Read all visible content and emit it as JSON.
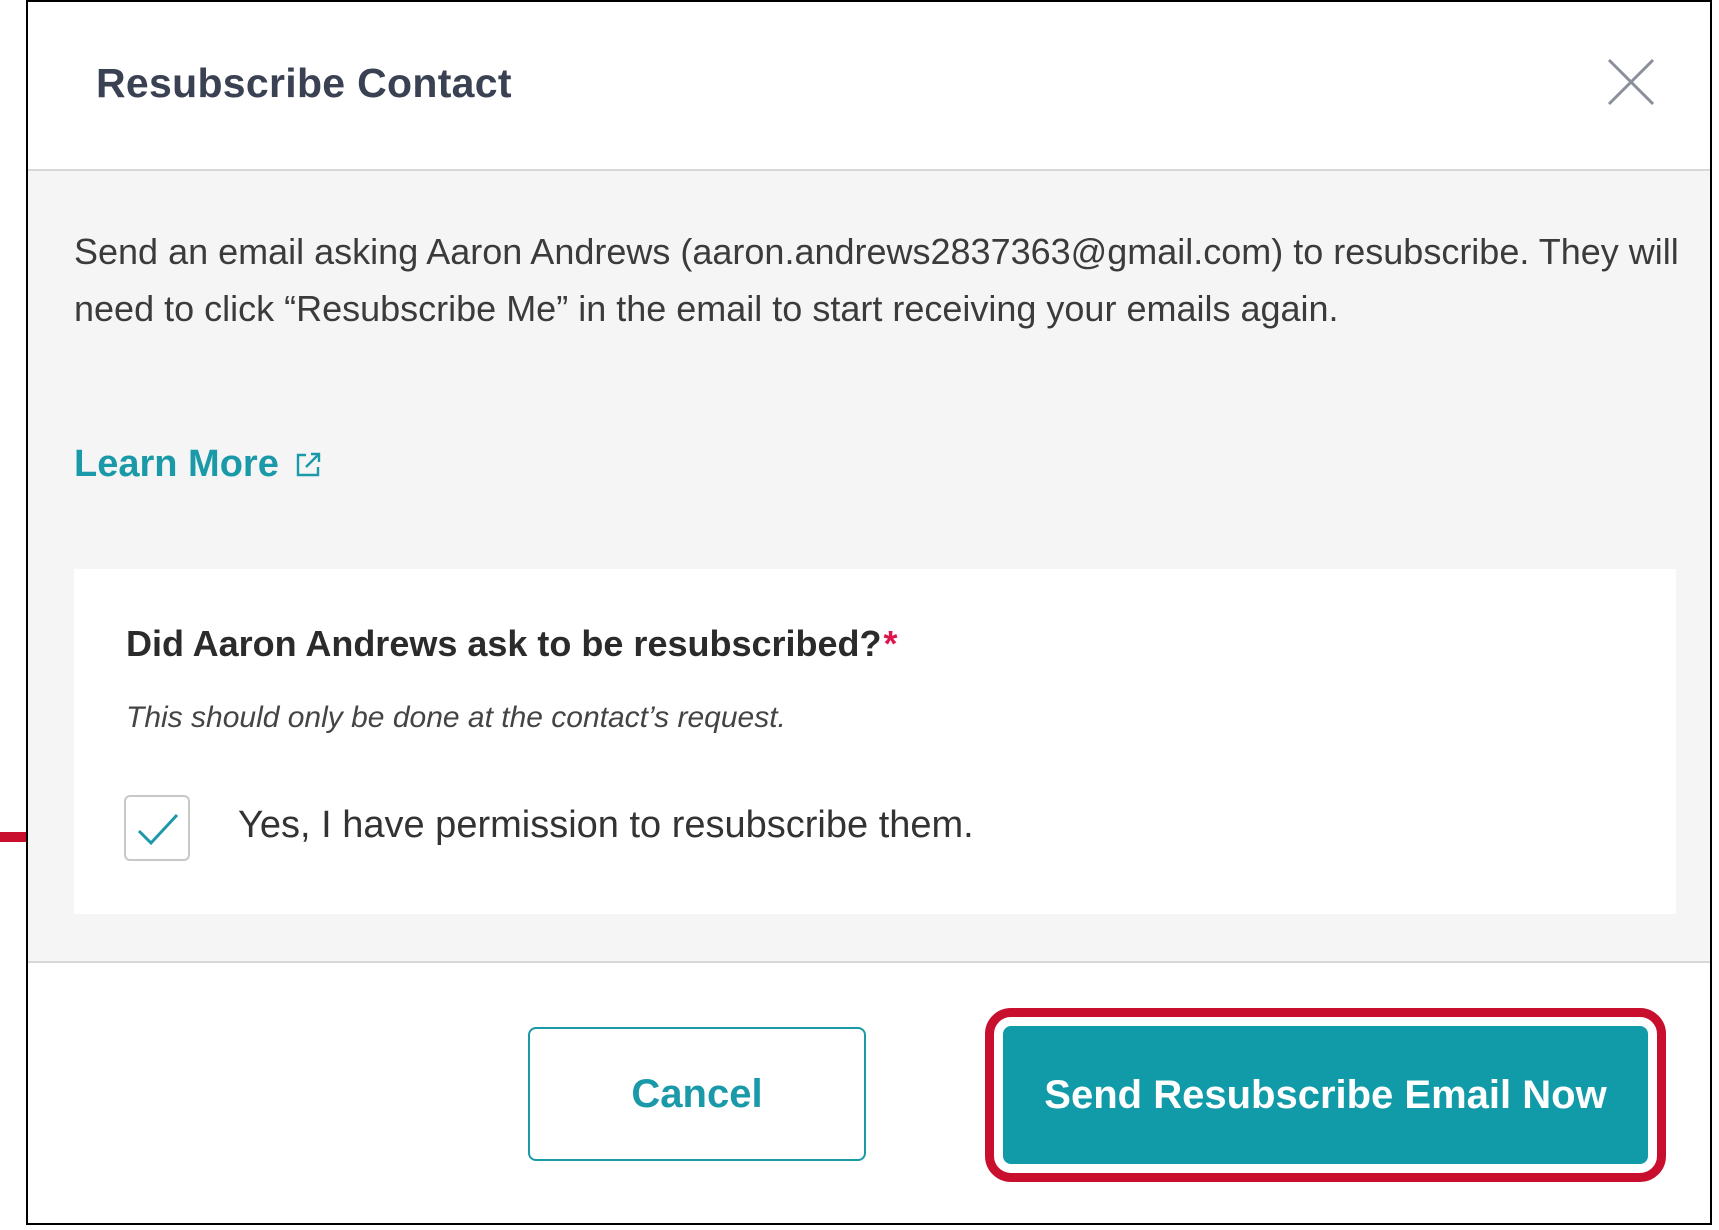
{
  "dialog": {
    "title": "Resubscribe Contact",
    "close_icon": "close-icon"
  },
  "body": {
    "description": "Send an email asking Aaron Andrews (aaron.andrews2837363@gmail.com) to resubscribe. They will need to click “Resubscribe Me” in the email to start receiving your emails again.",
    "learn_more": {
      "label": "Learn More",
      "icon": "external-link-icon"
    },
    "question": {
      "text": "Did Aaron Andrews ask to be resubscribed?",
      "required_marker": "*",
      "helper": "This should only be done at the contact’s request.",
      "checkbox": {
        "checked": true,
        "label": "Yes, I have permission to resubscribe them."
      }
    }
  },
  "footer": {
    "cancel_label": "Cancel",
    "send_label": "Send Resubscribe Email Now"
  },
  "annotations": {
    "arrow_icon": "red-arrow-icon",
    "highlight_color": "#c8102e"
  },
  "colors": {
    "accent": "#119aa7",
    "required": "#e0144c",
    "body_bg": "#f5f5f5"
  }
}
